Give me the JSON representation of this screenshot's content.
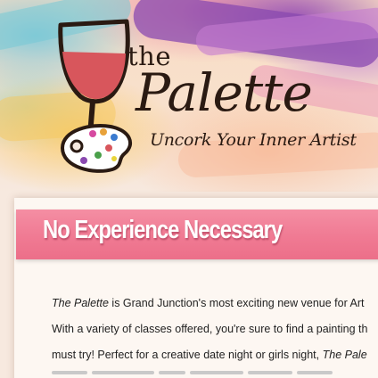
{
  "logo": {
    "word_the": "the",
    "word_palette": "Palette",
    "tagline": "Uncork Your Inner Artist"
  },
  "banner": {
    "title": "No Experience Necessary"
  },
  "body": {
    "line1_italic": "The Palette",
    "line1_rest": " is Grand Junction's most exciting new venue for Art",
    "line2": "With a variety of classes offered, you're sure to find a painting th",
    "line3_start": "must try! Perfect for a creative date night or girls night, ",
    "line3_italic": "The Pale"
  },
  "colors": {
    "banner_pink": "#f07a93",
    "wine_red": "#d8565c",
    "logo_ink": "#2a1a12"
  }
}
